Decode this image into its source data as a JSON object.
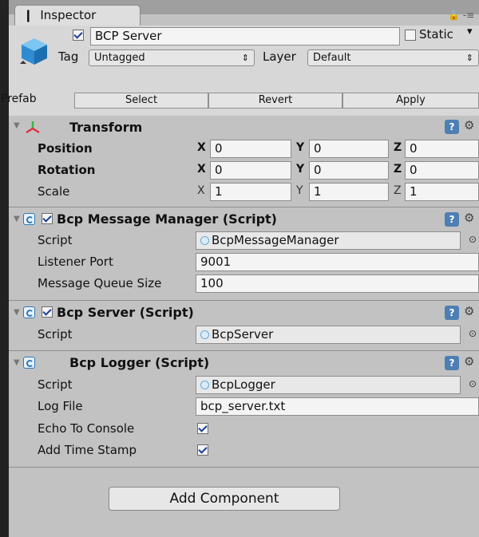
{
  "tab": {
    "title": "Inspector",
    "info_glyph": "❹"
  },
  "gameobject": {
    "name": "BCP Server",
    "active": true,
    "static_label": "Static",
    "static": false,
    "tag_label": "Tag",
    "tag_value": "Untagged",
    "layer_label": "Layer",
    "layer_value": "Default"
  },
  "prefab": {
    "label": "Prefab",
    "select": "Select",
    "revert": "Revert",
    "apply": "Apply"
  },
  "transform": {
    "title": "Transform",
    "rows": [
      {
        "label": "Position",
        "x": "0",
        "y": "0",
        "z": "0",
        "bold": true
      },
      {
        "label": "Rotation",
        "x": "0",
        "y": "0",
        "z": "0",
        "bold": true
      },
      {
        "label": "Scale",
        "x": "1",
        "y": "1",
        "z": "1",
        "bold": false
      }
    ],
    "axis": {
      "x": "X",
      "y": "Y",
      "z": "Z"
    }
  },
  "components": {
    "message_manager": {
      "title": "Bcp Message Manager (Script)",
      "enabled": true,
      "script_label": "Script",
      "script_value": "BcpMessageManager",
      "listener_port_label": "Listener Port",
      "listener_port_value": "9001",
      "queue_size_label": "Message Queue Size",
      "queue_size_value": "100"
    },
    "server": {
      "title": "Bcp Server (Script)",
      "enabled": true,
      "script_label": "Script",
      "script_value": "BcpServer"
    },
    "logger": {
      "title": "Bcp Logger (Script)",
      "script_label": "Script",
      "script_value": "BcpLogger",
      "log_file_label": "Log File",
      "log_file_value": "bcp_server.txt",
      "echo_label": "Echo To Console",
      "echo_checked": true,
      "timestamp_label": "Add Time Stamp",
      "timestamp_checked": true
    }
  },
  "add_component": "Add Component"
}
